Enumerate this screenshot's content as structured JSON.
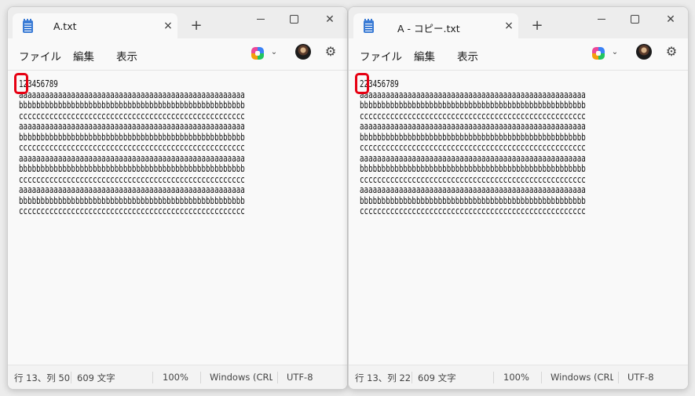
{
  "windows": [
    {
      "tab_title": "A.txt",
      "menu": [
        "ファイル",
        "編集",
        "表示"
      ],
      "text_lines": [
        "123456789",
        "aaaaaaaaaaaaaaaaaaaaaaaaaaaaaaaaaaaaaaaaaaaaaaaaaaaa",
        "bbbbbbbbbbbbbbbbbbbbbbbbbbbbbbbbbbbbbbbbbbbbbbbbbbbb",
        "cccccccccccccccccccccccccccccccccccccccccccccccccccc",
        "aaaaaaaaaaaaaaaaaaaaaaaaaaaaaaaaaaaaaaaaaaaaaaaaaaaa",
        "bbbbbbbbbbbbbbbbbbbbbbbbbbbbbbbbbbbbbbbbbbbbbbbbbbbb",
        "cccccccccccccccccccccccccccccccccccccccccccccccccccc",
        "aaaaaaaaaaaaaaaaaaaaaaaaaaaaaaaaaaaaaaaaaaaaaaaaaaaa",
        "bbbbbbbbbbbbbbbbbbbbbbbbbbbbbbbbbbbbbbbbbbbbbbbbbbbb",
        "cccccccccccccccccccccccccccccccccccccccccccccccccccc",
        "aaaaaaaaaaaaaaaaaaaaaaaaaaaaaaaaaaaaaaaaaaaaaaaaaaaa",
        "bbbbbbbbbbbbbbbbbbbbbbbbbbbbbbbbbbbbbbbbbbbbbbbbbbbb",
        "cccccccccccccccccccccccccccccccccccccccccccccccccccc"
      ],
      "status": {
        "position": "行 13、列 50",
        "chars": "609 文字",
        "zoom": "100%",
        "line_ending": "Windows (CRLF)",
        "encoding": "UTF-8"
      }
    },
    {
      "tab_title": "A - コピー.txt",
      "menu": [
        "ファイル",
        "編集",
        "表示"
      ],
      "text_lines": [
        "223456789",
        "aaaaaaaaaaaaaaaaaaaaaaaaaaaaaaaaaaaaaaaaaaaaaaaaaaaa",
        "bbbbbbbbbbbbbbbbbbbbbbbbbbbbbbbbbbbbbbbbbbbbbbbbbbbb",
        "cccccccccccccccccccccccccccccccccccccccccccccccccccc",
        "aaaaaaaaaaaaaaaaaaaaaaaaaaaaaaaaaaaaaaaaaaaaaaaaaaaa",
        "bbbbbbbbbbbbbbbbbbbbbbbbbbbbbbbbbbbbbbbbbbbbbbbbbbbb",
        "cccccccccccccccccccccccccccccccccccccccccccccccccccc",
        "aaaaaaaaaaaaaaaaaaaaaaaaaaaaaaaaaaaaaaaaaaaaaaaaaaaa",
        "bbbbbbbbbbbbbbbbbbbbbbbbbbbbbbbbbbbbbbbbbbbbbbbbbbbb",
        "cccccccccccccccccccccccccccccccccccccccccccccccccccc",
        "aaaaaaaaaaaaaaaaaaaaaaaaaaaaaaaaaaaaaaaaaaaaaaaaaaaa",
        "bbbbbbbbbbbbbbbbbbbbbbbbbbbbbbbbbbbbbbbbbbbbbbbbbbbb",
        "cccccccccccccccccccccccccccccccccccccccccccccccccccc"
      ],
      "status": {
        "position": "行 13、列 22",
        "chars": "609 文字",
        "zoom": "100%",
        "line_ending": "Windows (CRLF)",
        "encoding": "UTF-8"
      }
    }
  ],
  "icons": {
    "app": "notepad-icon",
    "close": "×",
    "new_tab": "+",
    "chevron": "⌄",
    "gear": "⚙",
    "win_close": "✕"
  },
  "colors": {
    "highlight": "#e60012",
    "titlebar": "#ededed",
    "editor_bg": "#f9f9f9"
  }
}
